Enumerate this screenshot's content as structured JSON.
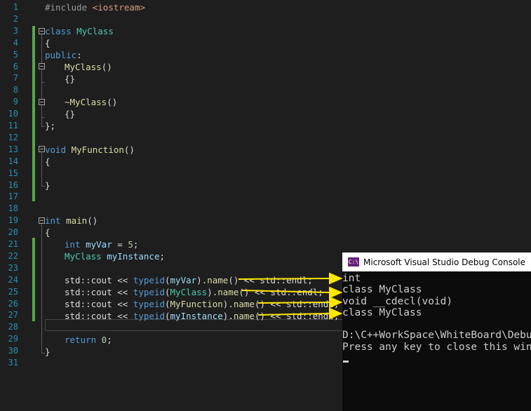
{
  "editor": {
    "line_numbers": [
      "1",
      "2",
      "3",
      "4",
      "5",
      "6",
      "7",
      "8",
      "9",
      "10",
      "11",
      "12",
      "13",
      "14",
      "15",
      "16",
      "17",
      "18",
      "19",
      "20",
      "21",
      "22",
      "23",
      "24",
      "25",
      "26",
      "27",
      "28",
      "29",
      "30",
      "31"
    ],
    "code": {
      "l1_pp": "#include",
      "l1_hdr": " <iostream>",
      "l3_kw": "class",
      "l3_name": " MyClass",
      "l4": "{",
      "l5_kw": "public",
      "l5_colon": ":",
      "l6_ctor": "MyClass",
      "l6_paren": "()",
      "l7": "{}",
      "l9_dtor": "~MyClass",
      "l9_paren": "()",
      "l10": "{}",
      "l11": "};",
      "l13_kw": "void",
      "l13_fn": " MyFunction",
      "l13_paren": "()",
      "l14": "{",
      "l16": "}",
      "l19_kw": "int",
      "l19_fn": " main",
      "l19_paren": "()",
      "l20": "{",
      "l21_kw": "int",
      "l21_var": " myVar",
      "l21_rest": " = ",
      "l21_num": "5",
      "l21_end": ";",
      "l22_ty": "MyClass",
      "l22_var": " myInstance",
      "l22_end": ";",
      "cout_pre": "std::cout << ",
      "typeid_kw": "typeid",
      "l24_arg": "myVar",
      "l25_arg": "MyClass",
      "l26_arg": "MyFunction",
      "l27_arg": "myInstance",
      "name_call_pre": ".",
      "name_fn": "name",
      "name_call_post": "() ",
      "endl_part": "<< std::endl;",
      "l29_kw": "return",
      "l29_num": " 0",
      "l29_end": ";",
      "l30": "}"
    }
  },
  "console": {
    "title": "Microsoft Visual Studio Debug Console",
    "icon_text": "C:\\",
    "output": "int\nclass MyClass\nvoid __cdecl(void)\nclass MyClass\n\nD:\\C++WorkSpace\\WhiteBoard\\Debug\\C\nPress any key to close this window"
  },
  "annotation_color": "#ffe600",
  "colors": {
    "keyword": "#569cd6",
    "type": "#4ec9b0",
    "function": "#dcdcaa",
    "variable": "#9cdcfe",
    "line_number": "#2b91af",
    "change_bar": "#57a64a"
  }
}
